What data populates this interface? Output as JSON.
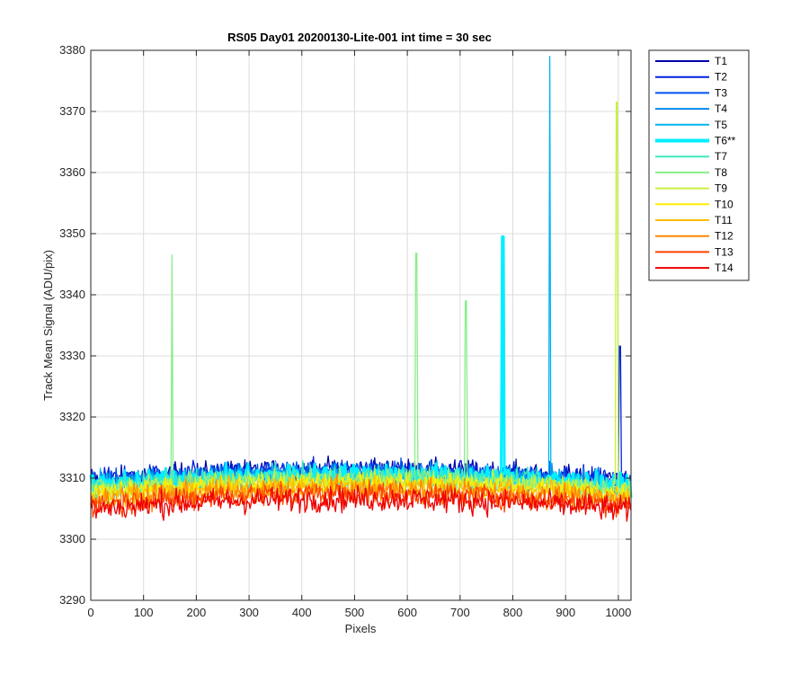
{
  "chart_data": {
    "type": "line",
    "title": "RS05 Day01 20200130-Lite-001 int time = 30 sec",
    "xlabel": "Pixels",
    "ylabel": "Track Mean Signal (ADU/pix)",
    "xlim": [
      0,
      1024
    ],
    "ylim": [
      3290,
      3380
    ],
    "xticks": [
      0,
      100,
      200,
      300,
      400,
      500,
      600,
      700,
      800,
      900,
      1000
    ],
    "yticks": [
      3290,
      3300,
      3310,
      3320,
      3330,
      3340,
      3350,
      3360,
      3370,
      3380
    ],
    "grid": true,
    "legend_position": "outside-top-right",
    "series": [
      {
        "name": "T1",
        "color": "#0000aa",
        "baseline": 3309.6,
        "noise": 1.3,
        "highlight": false,
        "spikes": []
      },
      {
        "name": "T2",
        "color": "#0022dd",
        "baseline": 3309.5,
        "noise": 1.3,
        "highlight": false,
        "spikes": [
          {
            "x": 1003,
            "y": 3331.6
          }
        ]
      },
      {
        "name": "T3",
        "color": "#0055ee",
        "baseline": 3309.2,
        "noise": 1.3,
        "highlight": false,
        "spikes": []
      },
      {
        "name": "T4",
        "color": "#0088ee",
        "baseline": 3309.0,
        "noise": 1.3,
        "highlight": false,
        "spikes": []
      },
      {
        "name": "T5",
        "color": "#00b4f0",
        "baseline": 3308.8,
        "noise": 1.3,
        "highlight": false,
        "spikes": [
          {
            "x": 870,
            "y": 3379.0
          }
        ]
      },
      {
        "name": "T6**",
        "color": "#00eeff",
        "baseline": 3308.7,
        "noise": 1.3,
        "highlight": true,
        "spikes": [
          {
            "x": 781,
            "y": 3349.5
          }
        ]
      },
      {
        "name": "T7",
        "color": "#40e8c0",
        "baseline": 3308.4,
        "noise": 1.3,
        "highlight": false,
        "spikes": []
      },
      {
        "name": "T8",
        "color": "#88ee88",
        "baseline": 3308.1,
        "noise": 1.3,
        "highlight": false,
        "spikes": [
          {
            "x": 154,
            "y": 3346.5
          },
          {
            "x": 617,
            "y": 3346.8
          },
          {
            "x": 711,
            "y": 3339.0
          }
        ]
      },
      {
        "name": "T9",
        "color": "#c8f040",
        "baseline": 3307.7,
        "noise": 1.3,
        "highlight": false,
        "spikes": [
          {
            "x": 997,
            "y": 3371.5
          }
        ]
      },
      {
        "name": "T10",
        "color": "#ffee00",
        "baseline": 3307.3,
        "noise": 1.3,
        "highlight": false,
        "spikes": []
      },
      {
        "name": "T11",
        "color": "#ffbb00",
        "baseline": 3306.8,
        "noise": 1.3,
        "highlight": false,
        "spikes": []
      },
      {
        "name": "T12",
        "color": "#ff8800",
        "baseline": 3306.2,
        "noise": 1.4,
        "highlight": false,
        "spikes": []
      },
      {
        "name": "T13",
        "color": "#ff4400",
        "baseline": 3305.6,
        "noise": 1.4,
        "highlight": false,
        "spikes": []
      },
      {
        "name": "T14",
        "color": "#ee0000",
        "baseline": 3304.8,
        "noise": 1.5,
        "highlight": false,
        "spikes": []
      }
    ]
  }
}
